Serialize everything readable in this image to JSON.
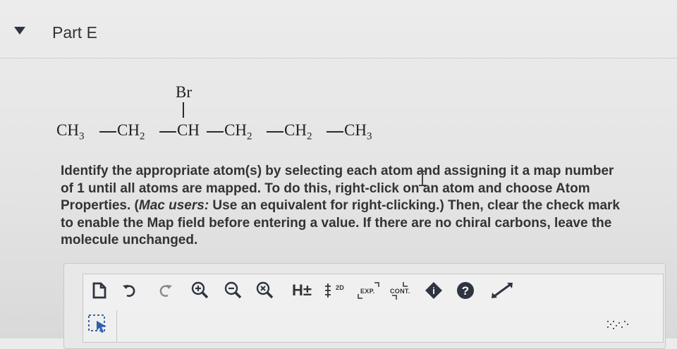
{
  "section": {
    "title": "Part E"
  },
  "molecule": {
    "substituent": "Br",
    "groups": [
      {
        "base": "CH",
        "sub": "3"
      },
      {
        "base": "CH",
        "sub": "2"
      },
      {
        "base": "CH",
        "sub": ""
      },
      {
        "base": "CH",
        "sub": "2"
      },
      {
        "base": "CH",
        "sub": "2"
      },
      {
        "base": "CH",
        "sub": "3"
      }
    ]
  },
  "question": {
    "text": "Identify the appropriate atom(s) by selecting each atom and assigning it a map number\nof 1 until all atoms are mapped. To do this, right-click on an atom and choose Atom\nProperties. (Mac users: Use an equivalent for right-clicking.) Then, clear the check mark\nto enable the Map field before entering a value. If there are no chiral carbons, leave the\nmolecule unchanged.",
    "prefix": "Properties. (",
    "mac_label": "Mac users:"
  },
  "toolbar": {
    "new_icon": "new-document-icon",
    "undo_icon": "undo-icon",
    "redo_icon": "redo-icon",
    "zoom_in_icon": "zoom-in-icon",
    "zoom_out_icon": "zoom-out-icon",
    "zoom_reset_icon": "zoom-reset-icon",
    "h_label": "H±",
    "clean_label": "2D",
    "exp_label": "EXP.",
    "cont_label": "CONT.",
    "info_label": "i",
    "help_label": "?",
    "expand_icon": "expand-icon"
  },
  "colors": {
    "background": "#e6e6e6",
    "text": "#333333",
    "icon_dark": "#2e3440"
  }
}
